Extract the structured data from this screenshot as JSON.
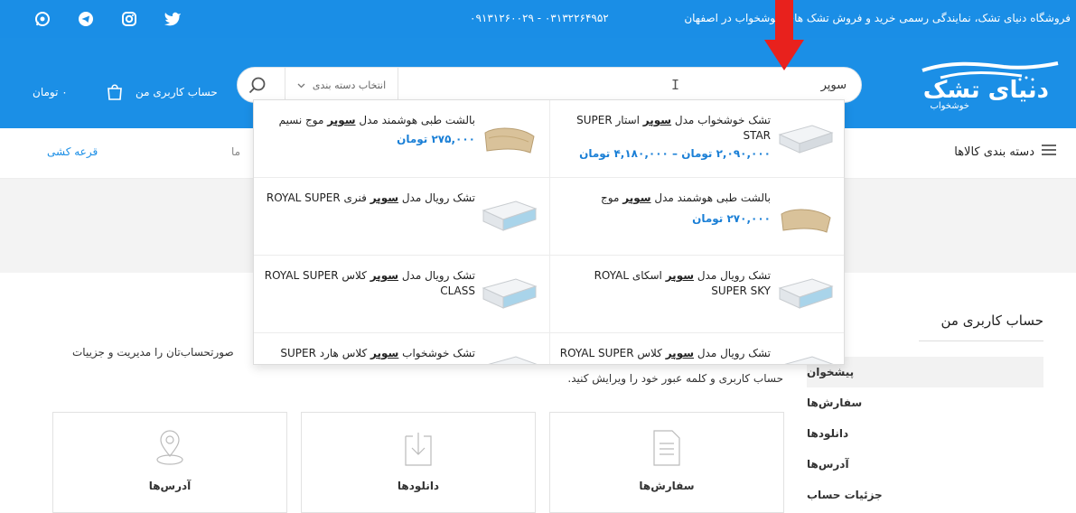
{
  "topbar": {
    "slogan": "فروشگاه دنیای تشک، نمایندگی رسمی خرید و فروش تشک های خوشخواب در اصفهان",
    "phone": "۰۹۱۳۱۲۶۰۰۲۹ - ۰۳۱۳۲۲۶۴۹۵۲",
    "social": [
      "whatsapp-icon",
      "telegram-icon",
      "instagram-icon",
      "twitter-icon"
    ]
  },
  "header": {
    "logo_text": "دنیای تشک",
    "logo_sub": "خوشخواب",
    "search_value": "سوپر",
    "category_placeholder": "انتخاب دسته بندی",
    "account_label": "حساب کاربری من",
    "cart_label": "۰ تومان"
  },
  "nav": {
    "categories_label": "دسته بندی کالاها",
    "lottery_label": "قرعه کشی",
    "truncated_label": "ما"
  },
  "dropdown": {
    "results": [
      {
        "title_pre": "تشک خوشخواب مدل ",
        "title_mark": "سوپر",
        "title_post": " استار SUPER STAR",
        "price": "۲,۰۹۰,۰۰۰ تومان – ۴,۱۸۰,۰۰۰ تومان",
        "thumb": "mattress"
      },
      {
        "title_pre": "بالشت طبی هوشمند مدل ",
        "title_mark": "سوپر",
        "title_post": " موج نسیم",
        "price": "۲۷۵,۰۰۰ تومان",
        "thumb": "pillow"
      },
      {
        "title_pre": "بالشت طبی هوشمند مدل ",
        "title_mark": "سوپر",
        "title_post": " موج",
        "price": "۲۷۰,۰۰۰ تومان",
        "thumb": "pillow"
      },
      {
        "title_pre": "تشک رویال مدل ",
        "title_mark": "سوپر",
        "title_post": " فنری ROYAL SUPER",
        "price": "",
        "thumb": "mattress"
      },
      {
        "title_pre": "تشک رویال مدل ",
        "title_mark": "سوپر",
        "title_post": " اسکای ROYAL SUPER SKY",
        "price": "",
        "thumb": "mattress"
      },
      {
        "title_pre": "تشک رویال مدل ",
        "title_mark": "سوپر",
        "title_post": " کلاس ROYAL SUPER CLASS",
        "price": "",
        "thumb": "mattress"
      },
      {
        "title_pre": "تشک رویال مدل ",
        "title_mark": "سوپر",
        "title_post": " کلاس ROYAL SUPER",
        "price": "",
        "thumb": "mattress"
      },
      {
        "title_pre": "تشک خوشخواب ",
        "title_mark": "سوپر",
        "title_post": " کلاس هارد SUPER",
        "price": "",
        "thumb": "mattress"
      }
    ]
  },
  "account": {
    "title": "حساب کاربری من",
    "menu": [
      "پیشخوان",
      "سفارش‌ها",
      "دانلودها",
      "آدرس‌ها",
      "جزئیات حساب"
    ],
    "welcome_right": "حساب کاربری و کلمه عبور خود را ویرایش کنید.",
    "welcome_left": "صورتحساب‌تان را مدیریت و جزییات",
    "cards": [
      {
        "label": "سفارش‌ها",
        "icon": "orders-icon"
      },
      {
        "label": "دانلودها",
        "icon": "download-icon"
      },
      {
        "label": "آدرس‌ها",
        "icon": "location-icon"
      }
    ]
  },
  "colors": {
    "primary": "#1a8ee6",
    "accent_arrow": "#e8211d",
    "price": "#1a7fd6"
  }
}
